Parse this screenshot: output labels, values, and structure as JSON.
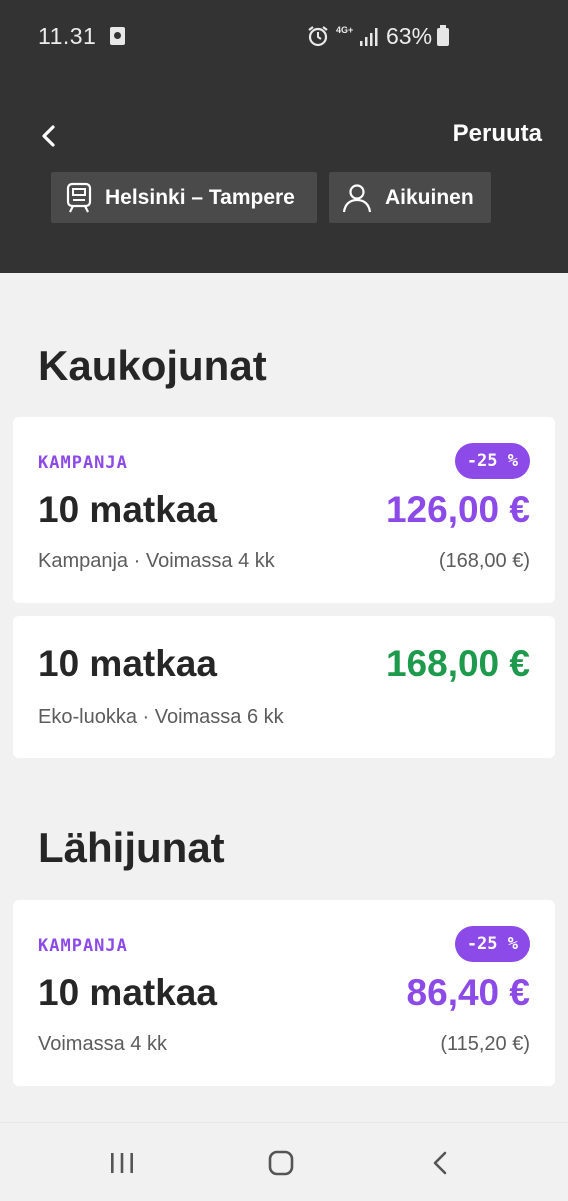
{
  "status_bar": {
    "time": "11.31",
    "network": "4G+",
    "battery": "63%"
  },
  "header": {
    "cancel_label": "Peruuta",
    "route_label": "Helsinki – Tampere",
    "passenger_label": "Aikuinen"
  },
  "sections": [
    {
      "title": "Kaukojunat",
      "cards": [
        {
          "tag": "KAMPANJA",
          "discount": "-25 %",
          "name": "10 matkaa",
          "price": "126,00 €",
          "description": "Kampanja · Voimassa 4 kk",
          "original_price": "(168,00 €)"
        },
        {
          "name": "10 matkaa",
          "price": "168,00 €",
          "description": "Eko-luokka · Voimassa 6 kk"
        }
      ]
    },
    {
      "title": "Lähijunat",
      "cards": [
        {
          "tag": "KAMPANJA",
          "discount": "-25 %",
          "name": "10 matkaa",
          "price": "86,40 €",
          "description": "Voimassa 4 kk",
          "original_price": "(115,20 €)"
        }
      ]
    }
  ],
  "colors": {
    "header_bg": "#333333",
    "campaign_purple": "#8c4ae8",
    "eco_green": "#1d9a4b",
    "page_bg": "#f1f1f1"
  }
}
